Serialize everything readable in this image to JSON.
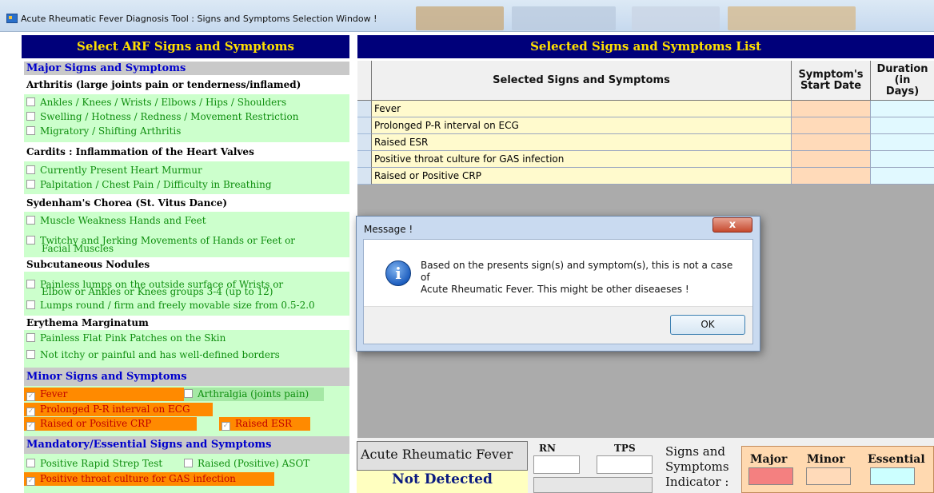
{
  "window": {
    "title": "Acute Rheumatic Fever Diagnosis Tool : Signs and Symptoms Selection Window !"
  },
  "left_panel": {
    "header": "Select ARF Signs and Symptoms",
    "major": {
      "title": "Major Signs and Symptoms",
      "arthritis": {
        "heading": "Arthritis (large joints pain or tenderness/inflamed)",
        "items": [
          "Ankles / Knees / Wrists / Elbows / Hips / Shoulders",
          "Swelling / Hotness / Redness / Movement Restriction",
          "Migratory / Shifting Arthritis"
        ]
      },
      "carditis": {
        "heading": "Cardits : Inflammation of the Heart Valves",
        "items": [
          "Currently Present Heart Murmur",
          "Palpitation / Chest Pain / Difficulty in Breathing"
        ]
      },
      "chorea": {
        "heading": "Sydenham's Chorea (St. Vitus Dance)",
        "item1": "Muscle Weakness Hands and Feet",
        "item2_line1": "Twitchy and Jerking Movements of Hands or Feet or",
        "item2_line2": "Facial Muscles"
      },
      "nodules": {
        "heading": "Subcutaneous Nodules",
        "item1_line1": "Painless lumps on the outside surface of Wrists or",
        "item1_line2": "Elbow or Ankles or Knees groups 3-4 (up to 12)",
        "item2": "Lumps round / firm and freely movable size from 0.5-2.0"
      },
      "erythema": {
        "heading": "Erythema Marginatum",
        "items": [
          "Painless Flat Pink Patches on the Skin",
          "Not itchy or painful and has well-defined borders"
        ]
      }
    },
    "minor": {
      "title": "Minor Signs and Symptoms",
      "fever": "Fever",
      "arthralgia": "Arthralgia (joints pain)",
      "pr_interval": "Prolonged P-R interval on ECG",
      "crp": "Raised or Positive CRP",
      "esr": "Raised ESR"
    },
    "mandatory": {
      "title": "Mandatory/Essential Signs and Symptoms",
      "rapid_strep": "Positive Rapid Strep Test",
      "aso": "Raised (Positive) ASOT",
      "throat_culture": "Positive throat culture for GAS infection"
    }
  },
  "right_panel": {
    "header": "Selected Signs and Symptoms List",
    "columns": {
      "symptom": "Selected Signs and Symptoms",
      "start_date_l1": "Symptom's",
      "start_date_l2": "Start Date",
      "duration_l1": "Duration",
      "duration_l2": "(in",
      "duration_l3": "Days)"
    },
    "rows": [
      "Fever",
      "Prolonged P-R interval on ECG",
      "Raised ESR",
      "Positive throat culture for GAS infection",
      "Raised or Positive CRP"
    ]
  },
  "bottom": {
    "arf_label": "Acute Rheumatic Fever",
    "arf_status": "Not Detected",
    "rn_label": "RN",
    "tps_label": "TPS",
    "indicator_line1": "Signs and",
    "indicator_line2": "Symptoms",
    "indicator_line3": "Indicator :",
    "major_label": "Major",
    "minor_label": "Minor",
    "essential_label": "Essential"
  },
  "dialog": {
    "title": "Message !",
    "close_glyph": "x",
    "icon_glyph": "i",
    "message_line1": "Based on the presents sign(s) and symptom(s), this is not a case of",
    "message_line2": "Acute Rheumatic Fever. This might be other diseaeses !",
    "ok_label": "OK"
  },
  "colors": {
    "header_bg": "#00007a",
    "header_text": "#ffe000",
    "checked_bg": "#ff8a00",
    "symptom_green": "#ccffcc",
    "major_swatch": "#f48080",
    "minor_swatch": "#ffdab9",
    "essential_swatch": "#ccffff"
  }
}
